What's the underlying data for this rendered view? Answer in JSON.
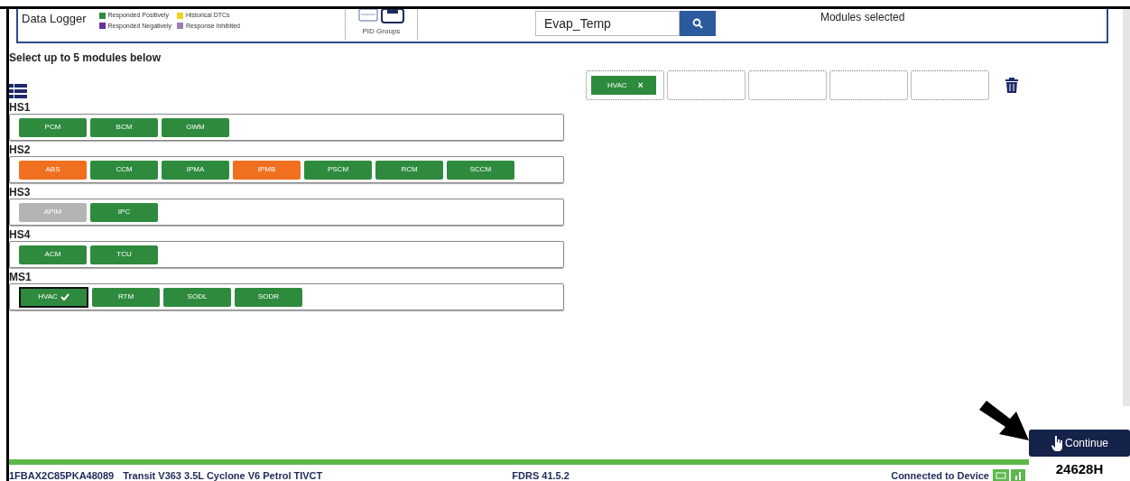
{
  "header": {
    "title": "Data Logger",
    "legend": [
      {
        "label": "Responded Positively",
        "color": "#2e8b3e"
      },
      {
        "label": "Historical DTCs",
        "color": "#f2d21b"
      },
      {
        "label": "Responded Negatively",
        "color": "#6a2e9e"
      },
      {
        "label": "Response Inhibited",
        "color": "#9a7fb0"
      }
    ],
    "pid_groups_label": "PID Groups",
    "search": {
      "value": "Evap_Temp"
    },
    "modules_selected_label": "Modules selected"
  },
  "instruction": "Select up to 5 modules below",
  "groups": [
    {
      "name": "HS1",
      "modules": [
        {
          "label": "PCM",
          "color": "#2e8b3e",
          "selected": false
        },
        {
          "label": "BCM",
          "color": "#2e8b3e",
          "selected": false
        },
        {
          "label": "GWM",
          "color": "#2e8b3e",
          "selected": false
        }
      ]
    },
    {
      "name": "HS2",
      "modules": [
        {
          "label": "ABS",
          "color": "#f07020",
          "selected": false
        },
        {
          "label": "CCM",
          "color": "#2e8b3e",
          "selected": false
        },
        {
          "label": "IPMA",
          "color": "#2e8b3e",
          "selected": false
        },
        {
          "label": "IPMB",
          "color": "#f07020",
          "selected": false
        },
        {
          "label": "PSCM",
          "color": "#2e8b3e",
          "selected": false
        },
        {
          "label": "RCM",
          "color": "#2e8b3e",
          "selected": false
        },
        {
          "label": "SCCM",
          "color": "#2e8b3e",
          "selected": false
        }
      ]
    },
    {
      "name": "HS3",
      "modules": [
        {
          "label": "APIM",
          "color": "#b4b4b4",
          "selected": false
        },
        {
          "label": "IPC",
          "color": "#2e8b3e",
          "selected": false
        }
      ]
    },
    {
      "name": "HS4",
      "modules": [
        {
          "label": "ACM",
          "color": "#2e8b3e",
          "selected": false
        },
        {
          "label": "TCU",
          "color": "#2e8b3e",
          "selected": false
        }
      ]
    },
    {
      "name": "MS1",
      "modules": [
        {
          "label": "HVAC",
          "color": "#2e8b3e",
          "selected": true
        },
        {
          "label": "RTM",
          "color": "#2e8b3e",
          "selected": false
        },
        {
          "label": "SODL",
          "color": "#2e8b3e",
          "selected": false
        },
        {
          "label": "SODR",
          "color": "#2e8b3e",
          "selected": false
        }
      ]
    }
  ],
  "slots": [
    {
      "kind": "chip",
      "label": "HVAC",
      "remove": "×"
    },
    {
      "kind": "empty"
    },
    {
      "kind": "empty"
    },
    {
      "kind": "empty"
    },
    {
      "kind": "empty"
    }
  ],
  "continue_button": "Continue",
  "status_bar": {
    "vin": "1FBAX2C85PKA48089",
    "vehicle": "Transit V363 3.5L Cyclone V6 Petrol TIVCT",
    "version": "FDRS 41.5.2",
    "connection": "Connected to Device"
  },
  "figure_label": "24628H"
}
